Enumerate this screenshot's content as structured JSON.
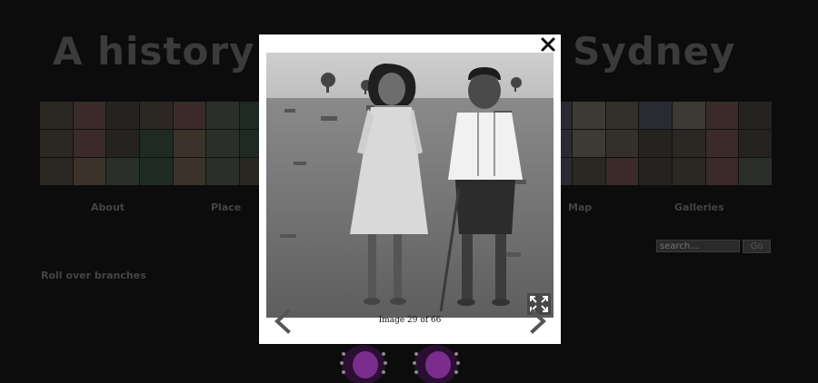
{
  "site": {
    "title": "A history of Aboriginal Sydney"
  },
  "nav": {
    "items": [
      {
        "label": "About"
      },
      {
        "label": "Place"
      },
      {
        "label": "Map"
      },
      {
        "label": "Galleries"
      }
    ]
  },
  "search": {
    "placeholder": "search...",
    "go_label": "Go"
  },
  "branches": {
    "hint": "Roll over branches"
  },
  "lightbox": {
    "counter": "Image 29 of 66"
  },
  "colors": {
    "overlay": "#0c0c0c",
    "modal_bg": "#ffffff",
    "accent_purple": "#7a2d8c"
  },
  "icons": {
    "close": "close-icon",
    "prev": "chevron-left-icon",
    "next": "chevron-right-icon",
    "expand": "expand-icon"
  }
}
